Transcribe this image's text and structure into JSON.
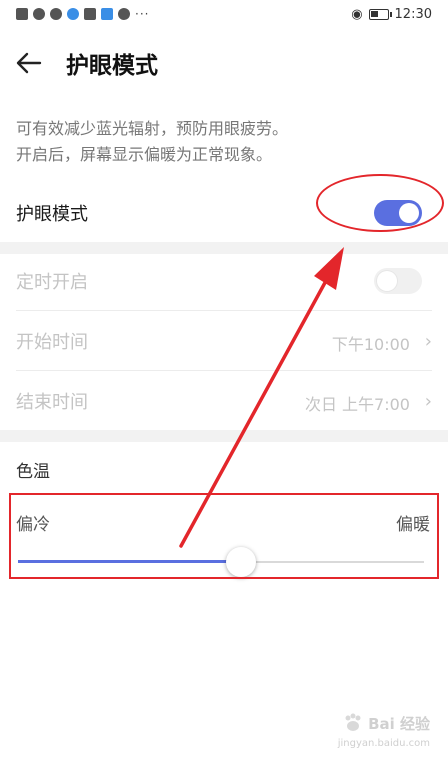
{
  "status_bar": {
    "time": "12:30"
  },
  "header": {
    "title": "护眼模式"
  },
  "description": {
    "line1": "可有效减少蓝光辐射，预防用眼疲劳。",
    "line2": "开启后，屏幕显示偏暖为正常现象。"
  },
  "eye_comfort": {
    "label": "护眼模式",
    "enabled": true
  },
  "schedule": {
    "label": "定时开启",
    "enabled": false,
    "start": {
      "label": "开始时间",
      "value": "下午10:00"
    },
    "end": {
      "label": "结束时间",
      "value": "次日 上午7:00"
    }
  },
  "color_temperature": {
    "title": "色温",
    "cool_label": "偏冷",
    "warm_label": "偏暖",
    "level": 0.55
  },
  "watermark": {
    "text": "Bai 经验",
    "sub": "jingyan.baidu.com"
  },
  "colors": {
    "accent": "#5a6fe0",
    "annotation": "#e3262b"
  }
}
